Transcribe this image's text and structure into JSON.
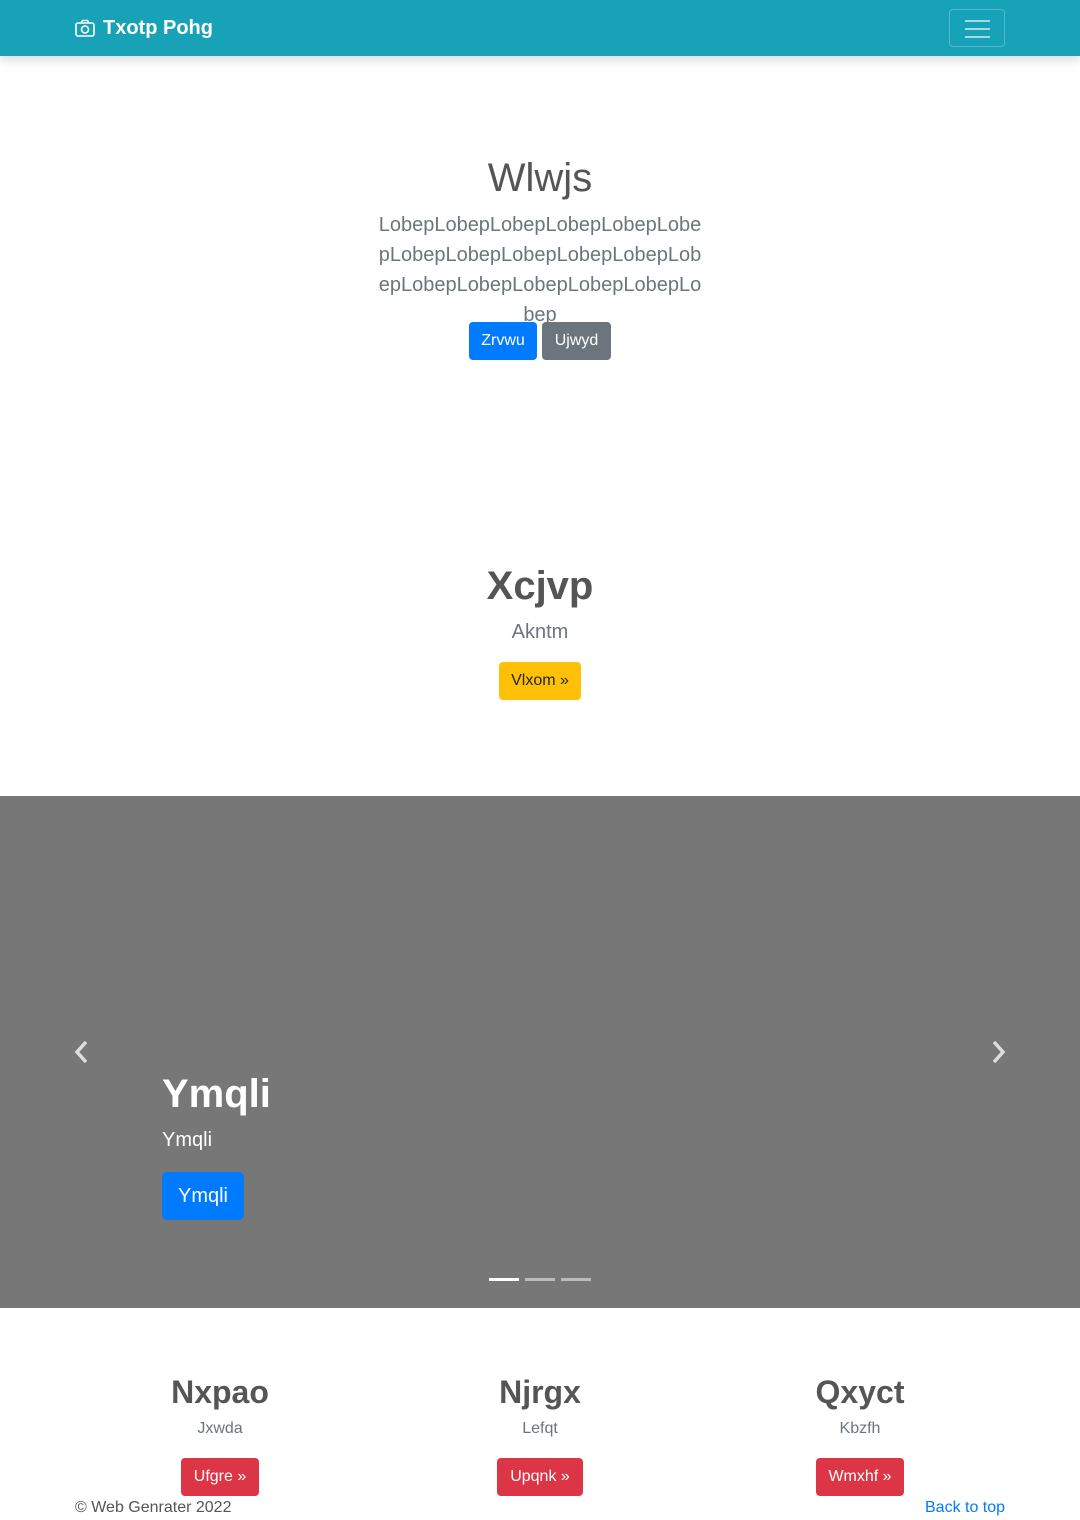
{
  "navbar": {
    "brand_icon": "camera-icon",
    "brand": "Txotp Pohg",
    "toggler_icon": "hamburger-icon",
    "color": "#17a2b8"
  },
  "hero": {
    "title": "Wlwjs",
    "text": "LobepLobepLobepLobepLobepLobepLobepLobepLobepLobepLobepLobepLobepLobepLobepLobepLobepLobep",
    "primary_button": "Zrvwu",
    "secondary_button": "Ujwyd"
  },
  "feature": {
    "title": "Xcjvp",
    "subtitle": "Akntm",
    "button": "Vlxom »"
  },
  "carousel": {
    "title": "Ymqli",
    "subtitle": "Ymqli",
    "button": "Ymqli",
    "prev_icon": "chevron-left-icon",
    "next_icon": "chevron-right-icon",
    "slide_count": 3,
    "active_index": 0,
    "background": "#777777"
  },
  "columns": [
    {
      "title": "Nxpao",
      "text": "Jxwda",
      "button": "Ufgre »"
    },
    {
      "title": "Njrgx",
      "text": "Lefqt",
      "button": "Upqnk »"
    },
    {
      "title": "Qxyct",
      "text": "Kbzfh",
      "button": "Wmxhf »"
    }
  ],
  "footer": {
    "copyright": "© Web Genrater 2022",
    "back_to_top": "Back to top"
  }
}
